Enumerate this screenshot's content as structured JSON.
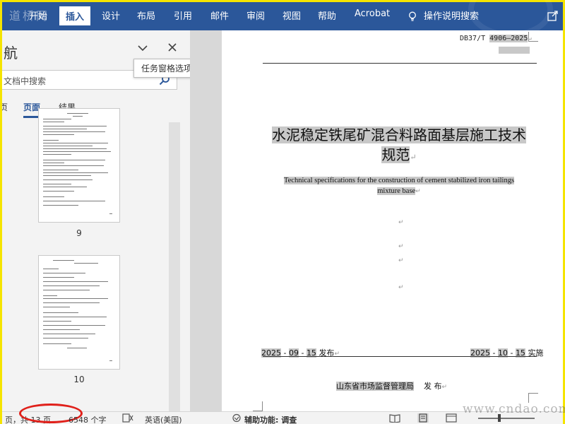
{
  "watermark": {
    "top_left": "道桥网",
    "bottom_right": "www.cndao.com"
  },
  "ribbon": {
    "tabs": [
      {
        "label": "开始"
      },
      {
        "label": "插入",
        "active": true
      },
      {
        "label": "设计"
      },
      {
        "label": "布局"
      },
      {
        "label": "引用"
      },
      {
        "label": "邮件"
      },
      {
        "label": "审阅"
      },
      {
        "label": "视图"
      },
      {
        "label": "帮助"
      },
      {
        "label": "Acrobat"
      }
    ],
    "tell_me": "操作说明搜索",
    "accent_color": "#2b579a"
  },
  "nav_pane": {
    "title": "航",
    "tooltip": "任务窗格选项",
    "search_placeholder": "文档中搜索",
    "tabs": [
      {
        "label": "页面",
        "active": true
      },
      {
        "label": "结果"
      }
    ],
    "thumbnails": [
      {
        "page": "9"
      },
      {
        "page": "10"
      }
    ]
  },
  "document": {
    "std_prefix": "DB37/T",
    "std_number": "4906—2025",
    "title_cn_line1": "水泥稳定铁尾矿混合料路面基层施工技术",
    "title_cn_line2": "规范",
    "title_en_line1": "Technical specifications for the construction of cement stabilized iron tailings",
    "title_en_line2": "mixture base",
    "pub_year": "2025",
    "pub_month": "09",
    "pub_day": "15",
    "pub_label": "发布",
    "eff_year": "2025",
    "eff_month": "10",
    "eff_day": "15",
    "eff_label": "实施",
    "issuer": "山东省市场监督管理局",
    "issuer_suffix": "发 布",
    "para_mark": "↵"
  },
  "status_bar": {
    "page_info": "页，共 13 页",
    "word_count": "6548 个字",
    "language": "英语(美国)",
    "accessibility": "辅助功能: 调查"
  }
}
